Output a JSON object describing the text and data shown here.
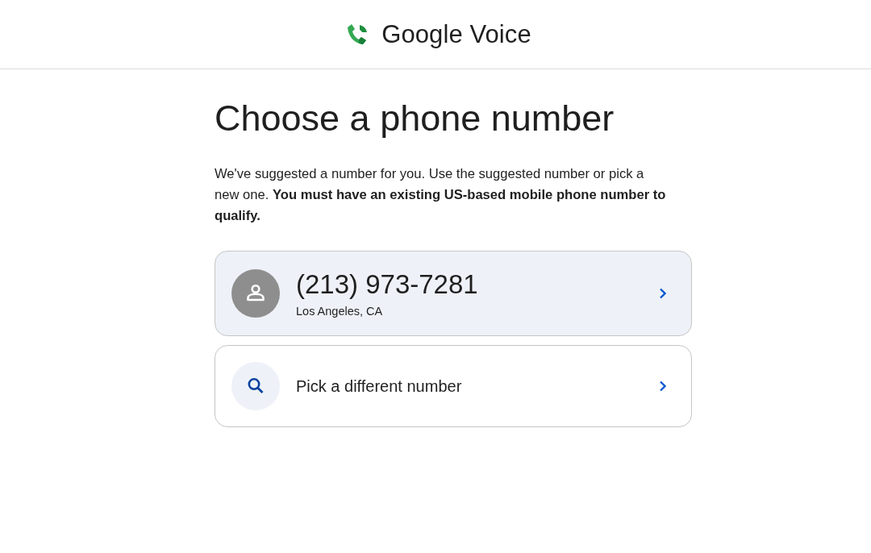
{
  "header": {
    "app_name": "Google Voice"
  },
  "title": "Choose a phone number",
  "description": "We've suggested a number for you. Use the suggested number or pick a new one. **You must have an existing US-based mobile phone number to qualify.**",
  "options": [
    {
      "kind": "number",
      "highlighted": true,
      "number": "(213) 973-7281",
      "location": "Los Angeles, CA"
    },
    {
      "kind": "search",
      "highlighted": false,
      "label": "Pick a different number"
    }
  ]
}
